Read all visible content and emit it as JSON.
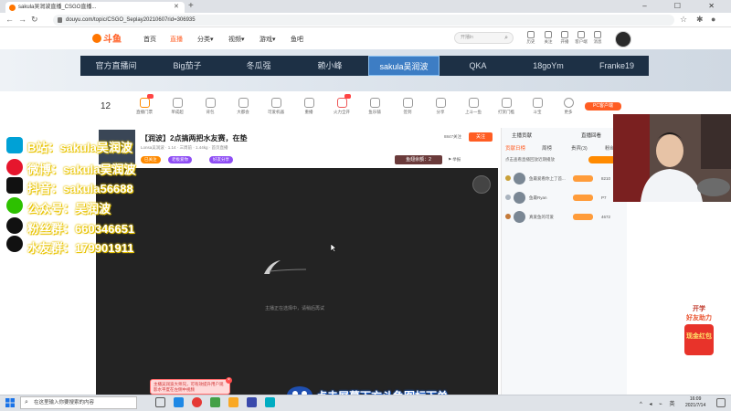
{
  "browser": {
    "tab_title": "sakula吴润波直播_CSGO直播...",
    "url": "douyu.com/topic/CSGO_Seplay20210607rid=306935",
    "window_controls": "– ☐ ✕"
  },
  "site": {
    "nav": [
      {
        "label": "首页",
        "active": false
      },
      {
        "label": "直播",
        "active": true
      },
      {
        "label": "分类▾",
        "active": false
      },
      {
        "label": "视频▾",
        "active": false
      },
      {
        "label": "游戏▾",
        "active": false
      },
      {
        "label": "鱼吧",
        "active": false
      }
    ],
    "search_placeholder": "开播ln",
    "header_icons": [
      "历史",
      "关注",
      "开播",
      "客户端",
      "消息"
    ]
  },
  "banner": {
    "streamers": [
      "官方直播间",
      "Big茄子",
      "冬瓜强",
      "赖小峰",
      "sakula吴润波",
      "QKA",
      "18goYm",
      "Franke19"
    ],
    "selected_index": 4
  },
  "toolbar": {
    "count": "12",
    "items": [
      "直播门票",
      "单成超",
      "背包",
      "大都会",
      "可爱机器",
      "重播",
      "火力全开",
      "鱼乐铺",
      "签到",
      "分享",
      "上斗一鱼",
      "打赏门槛",
      "斗宝",
      "更多"
    ],
    "pc_button": "PC客户端"
  },
  "room": {
    "title": "【润波】2点搞两把水友赛，在垫",
    "meta": "Lonsa吴润波  ·  1.14  ·  三周前  ·  1.44kg  ·  首页直播",
    "fans": "8847关注",
    "follow_label": "关注",
    "tags": [
      "已关注",
      "老板爱你",
      "好友分享"
    ],
    "coins_label": "鱼翅余额：2"
  },
  "video": {
    "loading_text": "主播正在选择中，请稍后再试"
  },
  "side_panel": {
    "tabs": [
      "贡献日榜",
      "周榜",
      "贵宾(3)",
      "粉丝"
    ],
    "header_left": "主播贡献",
    "header_right": "直播回看",
    "notice": "点击查看直播回放近期播放",
    "rows": [
      {
        "name": "鱼最爱看你上了首...",
        "value": "8210"
      },
      {
        "name": "鱼最Ryan",
        "value": "P7"
      },
      {
        "name": "真爱鱼的可爱",
        "value": "4672"
      }
    ]
  },
  "overlay": {
    "lines": [
      {
        "icon": "bilibili-icon",
        "text": "B站：sakula吴润波"
      },
      {
        "icon": "weibo-icon",
        "text": "微博：sakula吴润波"
      },
      {
        "icon": "douyin-icon",
        "text": "抖音：sakula56688"
      },
      {
        "icon": "wechat-icon",
        "text": "公众号：吴润波"
      },
      {
        "icon": "qq-icon",
        "text": "粉丝群：660346651"
      },
      {
        "icon": "qq-icon",
        "text": "水友群：179901911"
      }
    ],
    "bottom_text": "点击屏幕下方斗鱼图标下单",
    "promo_text": "主播吴润波大师兄，可有效提升用户观影水平度在左侧中视频",
    "redpack_top": "开学",
    "redpack_mid": "好友助力",
    "redpack_bottom": "现金红包"
  },
  "taskbar": {
    "search_placeholder": "在这里输入你要搜索的内容",
    "time": "16:09",
    "date": "2021/7/14",
    "ime": "英"
  },
  "colors": {
    "brand": "#ff5d23",
    "banner_bar": "#1d3045",
    "banner_selected": "#3d7dc4",
    "video_bg": "#232323",
    "overlay_glow": "#e8c300"
  }
}
